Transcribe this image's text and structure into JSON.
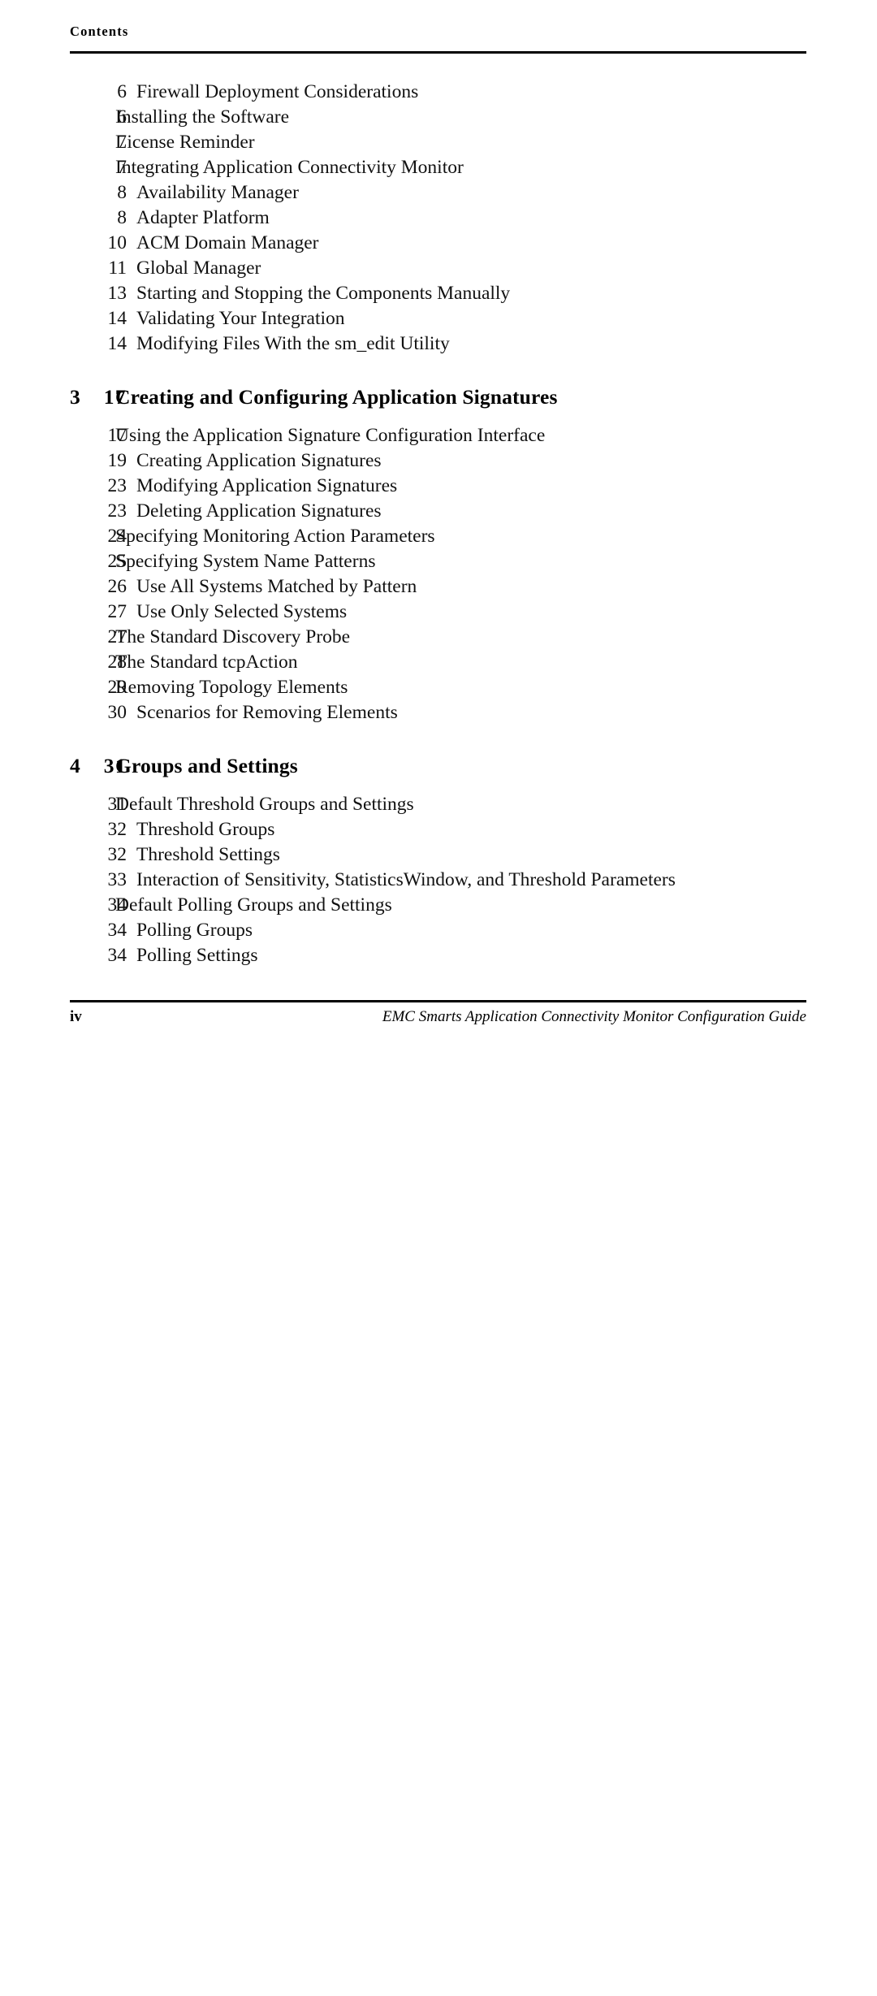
{
  "header": {
    "title": "Contents"
  },
  "toc": {
    "sections": [
      {
        "type": "entries",
        "entries": [
          {
            "level": 2,
            "label": "Firewall Deployment Considerations",
            "page": "6"
          },
          {
            "level": 1,
            "label": "Installing the Software",
            "page": "6"
          },
          {
            "level": 1,
            "label": "License Reminder",
            "page": "7"
          },
          {
            "level": 1,
            "label": "Integrating Application Connectivity Monitor",
            "page": "7"
          },
          {
            "level": 2,
            "label": "Availability Manager",
            "page": "8"
          },
          {
            "level": 2,
            "label": "Adapter Platform",
            "page": "8"
          },
          {
            "level": 2,
            "label": "ACM Domain Manager",
            "page": "10"
          },
          {
            "level": 2,
            "label": "Global Manager",
            "page": "11"
          },
          {
            "level": 2,
            "label": "Starting and Stopping the Components Manually",
            "page": "13"
          },
          {
            "level": 2,
            "label": "Validating Your Integration",
            "page": "14"
          },
          {
            "level": 2,
            "label": "Modifying Files With the sm_edit Utility",
            "page": "14"
          }
        ]
      },
      {
        "type": "chapter",
        "number": "3",
        "label": "Creating and Configuring Application Signatures",
        "page": "17",
        "entries": [
          {
            "level": 1,
            "label": "Using the Application Signature Configuration Interface",
            "page": "17"
          },
          {
            "level": 2,
            "label": "Creating Application Signatures",
            "page": "19"
          },
          {
            "level": 2,
            "label": "Modifying Application Signatures",
            "page": "23"
          },
          {
            "level": 2,
            "label": "Deleting Application Signatures",
            "page": "23"
          },
          {
            "level": 1,
            "label": "Specifying Monitoring Action Parameters",
            "page": "24"
          },
          {
            "level": 1,
            "label": "Specifying System Name Patterns",
            "page": "25"
          },
          {
            "level": 2,
            "label": "Use All Systems Matched by Pattern",
            "page": "26"
          },
          {
            "level": 2,
            "label": "Use Only Selected Systems",
            "page": "27"
          },
          {
            "level": 1,
            "label": "The Standard Discovery Probe",
            "page": "27"
          },
          {
            "level": 1,
            "label": "The Standard tcpAction",
            "page": "28"
          },
          {
            "level": 1,
            "label": "Removing Topology Elements",
            "page": "29"
          },
          {
            "level": 2,
            "label": "Scenarios for Removing Elements",
            "page": "30"
          }
        ]
      },
      {
        "type": "chapter",
        "number": "4",
        "label": "Groups and Settings",
        "page": "31",
        "entries": [
          {
            "level": 1,
            "label": "Default Threshold Groups and Settings",
            "page": "31"
          },
          {
            "level": 2,
            "label": "Threshold Groups",
            "page": "32"
          },
          {
            "level": 2,
            "label": "Threshold Settings",
            "page": "32"
          },
          {
            "level": 2,
            "label": "Interaction of Sensitivity, StatisticsWindow, and Threshold Parameters",
            "page": "33"
          },
          {
            "level": 1,
            "label": "Default Polling Groups and Settings",
            "page": "34"
          },
          {
            "level": 2,
            "label": "Polling Groups",
            "page": "34"
          },
          {
            "level": 2,
            "label": "Polling Settings",
            "page": "34"
          }
        ]
      }
    ]
  },
  "footer": {
    "page_label": "iv",
    "guide_title": "EMC Smarts Application Connectivity Monitor Configuration Guide"
  }
}
